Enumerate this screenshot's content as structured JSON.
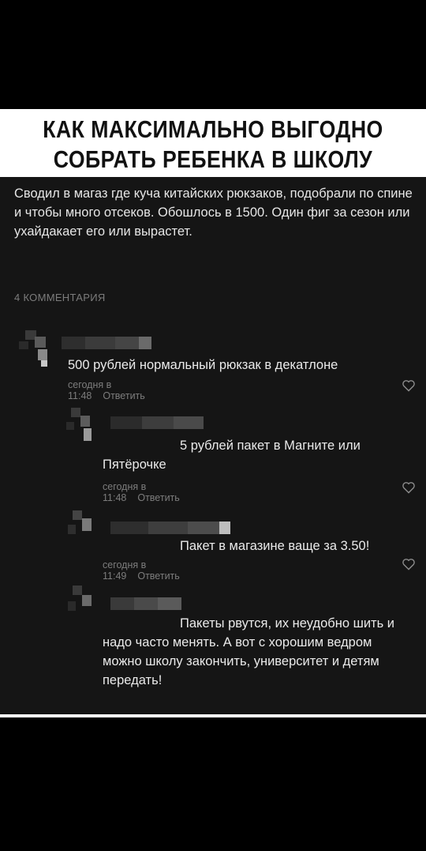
{
  "headline": {
    "line1": "КАК МАКСИМАЛЬНО ВЫГОДНО",
    "line2": "СОБРАТЬ РЕБЕНКА В ШКОЛУ"
  },
  "post": {
    "text": "Сводил в магаз где куча китайских рюкзаков, подобрали по спине и чтобы много отсеков. Обошлось в 1500. Один фиг за сезон или ухайдакает его или вырастет."
  },
  "comments_count": "4 КОММЕНТАРИЯ",
  "comments": [
    {
      "text": "500 рублей нормальный рюкзак в декатлоне",
      "time": "сегодня в 11:48",
      "reply": "Ответить"
    },
    {
      "text": "5 рублей пакет в Магните или Пятёрочке",
      "time": "сегодня в 11:48",
      "reply": "Ответить"
    },
    {
      "text": "Пакет в магазине ваще за 3.50!",
      "time": "сегодня в 11:49",
      "reply": "Ответить"
    },
    {
      "text": "Пакеты рвутся, их неудобно шить и надо часто менять. А вот с хорошим ведром можно школу закончить, университет и детям передать!"
    }
  ],
  "colors": {
    "background": "#000000",
    "card": "#151515",
    "text": "#e6e6e6",
    "muted": "#7d7d7d"
  },
  "icons": {
    "like": "heart-outline-icon"
  }
}
